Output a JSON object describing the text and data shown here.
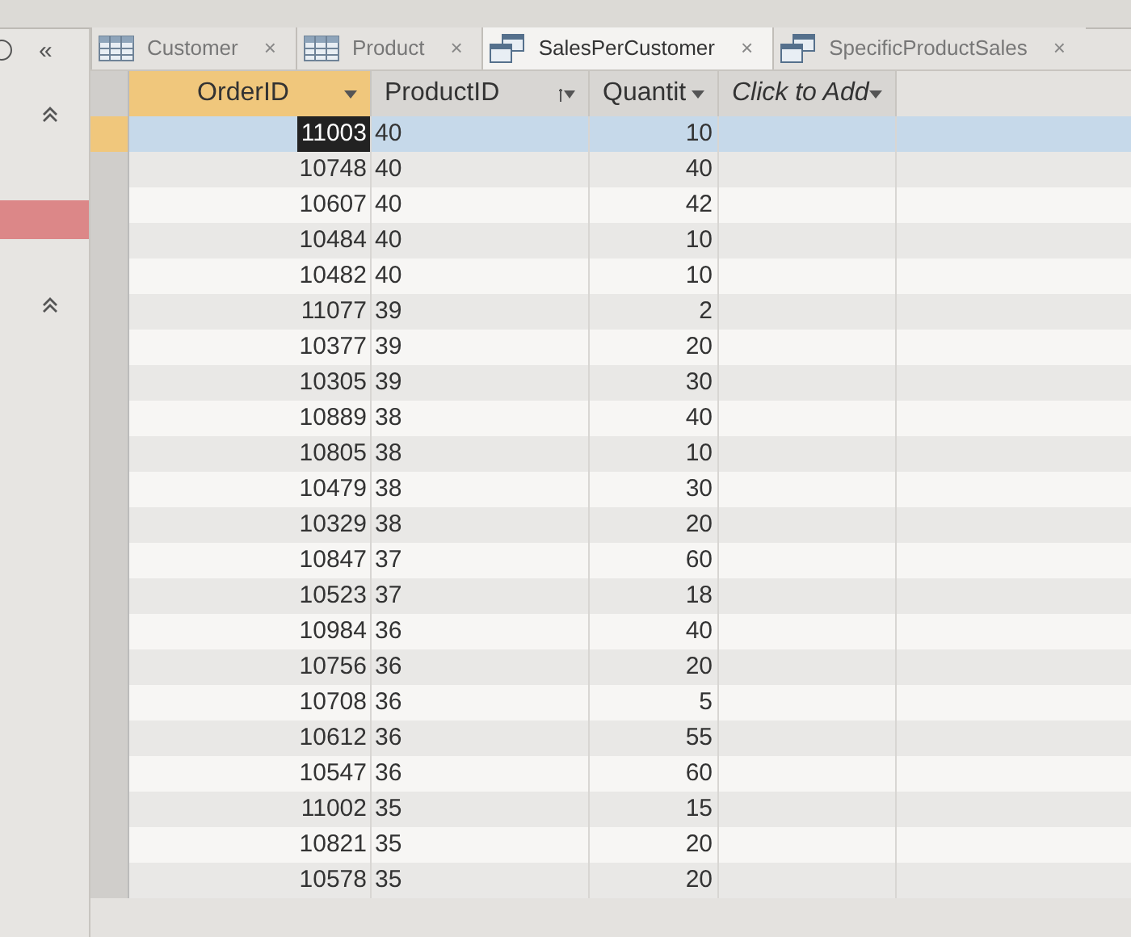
{
  "tabs": [
    {
      "label": "Customer",
      "kind": "table",
      "selected": false
    },
    {
      "label": "Product",
      "kind": "table",
      "selected": false
    },
    {
      "label": "SalesPerCustomer",
      "kind": "query",
      "selected": true
    },
    {
      "label": "SpecificProductSales",
      "kind": "query",
      "selected": false
    }
  ],
  "tab_close": "×",
  "nav_pane": {
    "collapse": "«"
  },
  "columns": [
    {
      "label": "OrderID",
      "kind": "key"
    },
    {
      "label": "ProductID",
      "kind": "sorted"
    },
    {
      "label": "Quantit",
      "kind": "plain"
    },
    {
      "label": "Click to Add",
      "kind": "add"
    }
  ],
  "rows": [
    {
      "order_id": "11003",
      "product_id": "40",
      "quantity": "10",
      "selected": true
    },
    {
      "order_id": "10748",
      "product_id": "40",
      "quantity": "40",
      "selected": false
    },
    {
      "order_id": "10607",
      "product_id": "40",
      "quantity": "42",
      "selected": false
    },
    {
      "order_id": "10484",
      "product_id": "40",
      "quantity": "10",
      "selected": false
    },
    {
      "order_id": "10482",
      "product_id": "40",
      "quantity": "10",
      "selected": false
    },
    {
      "order_id": "11077",
      "product_id": "39",
      "quantity": "2",
      "selected": false
    },
    {
      "order_id": "10377",
      "product_id": "39",
      "quantity": "20",
      "selected": false
    },
    {
      "order_id": "10305",
      "product_id": "39",
      "quantity": "30",
      "selected": false
    },
    {
      "order_id": "10889",
      "product_id": "38",
      "quantity": "40",
      "selected": false
    },
    {
      "order_id": "10805",
      "product_id": "38",
      "quantity": "10",
      "selected": false
    },
    {
      "order_id": "10479",
      "product_id": "38",
      "quantity": "30",
      "selected": false
    },
    {
      "order_id": "10329",
      "product_id": "38",
      "quantity": "20",
      "selected": false
    },
    {
      "order_id": "10847",
      "product_id": "37",
      "quantity": "60",
      "selected": false
    },
    {
      "order_id": "10523",
      "product_id": "37",
      "quantity": "18",
      "selected": false
    },
    {
      "order_id": "10984",
      "product_id": "36",
      "quantity": "40",
      "selected": false
    },
    {
      "order_id": "10756",
      "product_id": "36",
      "quantity": "20",
      "selected": false
    },
    {
      "order_id": "10708",
      "product_id": "36",
      "quantity": "5",
      "selected": false
    },
    {
      "order_id": "10612",
      "product_id": "36",
      "quantity": "55",
      "selected": false
    },
    {
      "order_id": "10547",
      "product_id": "36",
      "quantity": "60",
      "selected": false
    },
    {
      "order_id": "11002",
      "product_id": "35",
      "quantity": "15",
      "selected": false
    },
    {
      "order_id": "10821",
      "product_id": "35",
      "quantity": "20",
      "selected": false
    },
    {
      "order_id": "10578",
      "product_id": "35",
      "quantity": "20",
      "selected": false
    }
  ]
}
